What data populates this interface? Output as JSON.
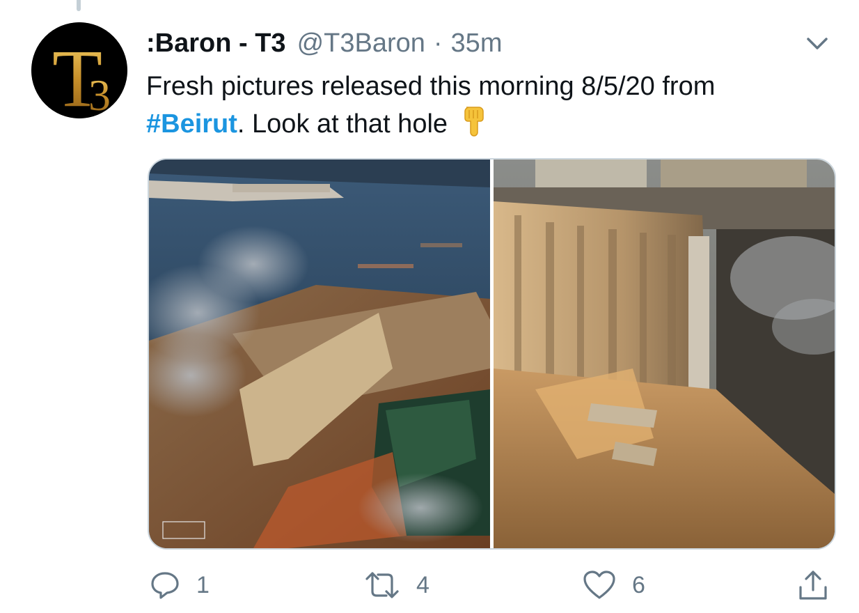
{
  "tweet": {
    "author": {
      "display_name": ":Baron - T3",
      "handle": "@T3Baron",
      "avatar_text": "T3"
    },
    "separator": "·",
    "time": "35m",
    "text_part1": "Fresh pictures released this morning 8/5/20 from",
    "hashtag": "#Beirut",
    "text_part2": ". Look at that hole",
    "emoji": "👇",
    "actions": {
      "replies": "1",
      "retweets": "4",
      "likes": "6"
    }
  },
  "colors": {
    "link": "#1b95e0",
    "secondary_text": "#657786",
    "primary_text": "#0f1419"
  },
  "icons": [
    "chevron-down-icon",
    "reply-icon",
    "retweet-icon",
    "like-icon",
    "share-icon"
  ]
}
